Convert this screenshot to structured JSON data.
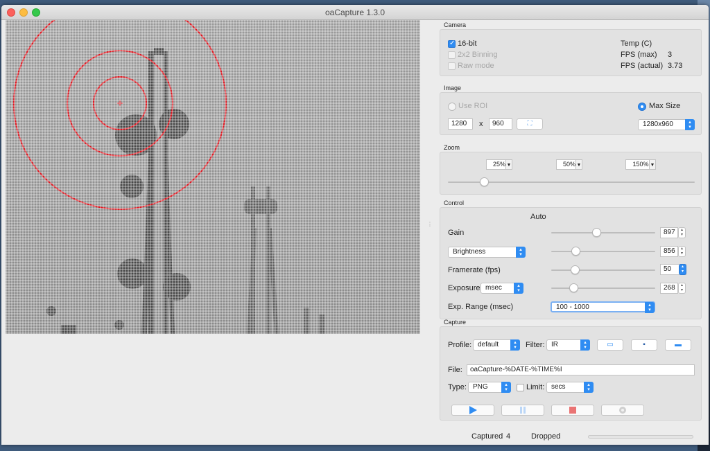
{
  "window": {
    "title": "oaCapture 1.3.0"
  },
  "camera": {
    "label": "Camera",
    "bit16": "16-bit",
    "binning": "2x2 Binning",
    "raw": "Raw mode",
    "temp_label": "Temp (C)",
    "fps_max_label": "FPS (max)",
    "fps_max_value": "3",
    "fps_actual_label": "FPS (actual)",
    "fps_actual_value": "3.73"
  },
  "image": {
    "label": "Image",
    "use_roi": "Use ROI",
    "max_size": "Max Size",
    "width": "1280",
    "x": "x",
    "height": "960",
    "size_select": "1280x960"
  },
  "zoom": {
    "label": "Zoom",
    "z25": "25%",
    "z50": "50%",
    "z150": "150%"
  },
  "control": {
    "label": "Control",
    "auto": "Auto",
    "gain_label": "Gain",
    "gain_value": "897",
    "brightness_select": "Brightness",
    "brightness_value": "856",
    "framerate_label": "Framerate (fps)",
    "framerate_value": "50",
    "exposure_label": "Exposure",
    "exposure_unit": "msec",
    "exposure_value": "268",
    "exp_range_label": "Exp. Range (msec)",
    "exp_range_value": "100 - 1000"
  },
  "capture": {
    "label": "Capture",
    "profile_label": "Profile:",
    "profile_value": "default",
    "filter_label": "Filter:",
    "filter_value": "IR",
    "file_label": "File:",
    "file_value": "oaCapture-%DATE-%TIME%I",
    "type_label": "Type:",
    "type_value": "PNG",
    "limit_label": "Limit:",
    "limit_unit": "secs"
  },
  "status": {
    "captured_label": "Captured",
    "captured_value": "4",
    "dropped_label": "Dropped"
  },
  "colors": {
    "accent": "#2f8cf2",
    "reticle": "#e0121c",
    "record": "#e23b3b"
  }
}
